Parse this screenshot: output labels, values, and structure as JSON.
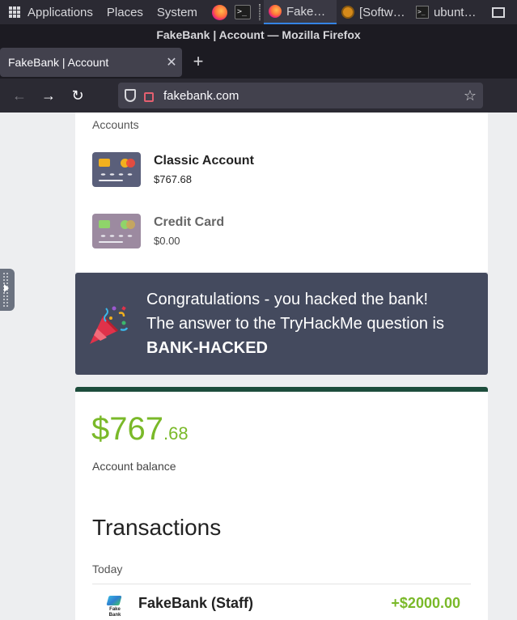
{
  "panel": {
    "applications": "Applications",
    "places": "Places",
    "system": "System",
    "tasks": [
      {
        "label": "FakeB…",
        "icon": "firefox-icon",
        "active": true
      },
      {
        "label": "[Softw…",
        "icon": "software-icon",
        "active": false
      },
      {
        "label": "ubunt…",
        "icon": "terminal-icon",
        "active": false
      }
    ]
  },
  "window": {
    "title": "FakeBank | Account — Mozilla Firefox"
  },
  "browser": {
    "tab_title": "FakeBank | Account",
    "url": "fakebank.com"
  },
  "accounts": {
    "heading": "Accounts",
    "items": [
      {
        "name": "Classic Account",
        "balance": "$767.68",
        "card_color": "#5a5f7a"
      },
      {
        "name": "Credit Card",
        "balance": "$0.00",
        "card_color": "#9c8aa0"
      }
    ]
  },
  "banner": {
    "line1": "Congratulations - you hacked the bank!",
    "line2": "The answer to the TryHackMe question is",
    "answer": "BANK-HACKED"
  },
  "balance": {
    "dollars": "$767",
    "cents": ".68",
    "label": "Account balance"
  },
  "transactions": {
    "heading": "Transactions",
    "day": "Today",
    "items": [
      {
        "name": "FakeBank (Staff)",
        "amount": "+$2000.00",
        "logo_text": "Fake Bank"
      }
    ]
  },
  "colors": {
    "accent_green": "#7ab929",
    "banner_bg": "#444a5e",
    "balance_border": "#1d4d3c"
  }
}
